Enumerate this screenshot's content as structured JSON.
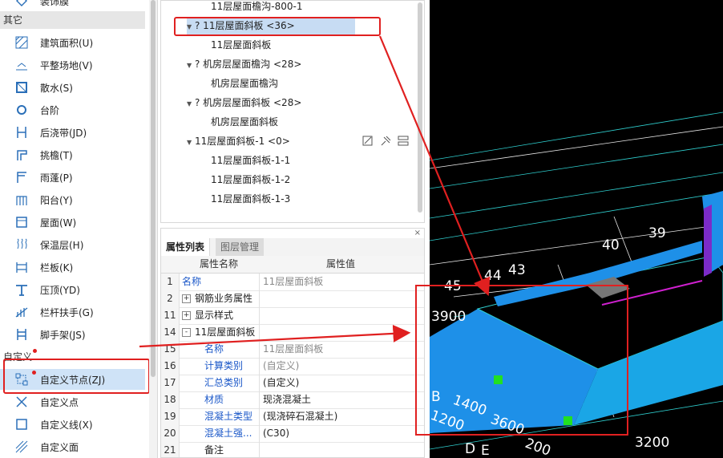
{
  "left_panel": {
    "top_partial_label": "装饰膜",
    "category_other": "其它",
    "items": [
      {
        "label": "建筑面积(U)",
        "icon": "area-hatch-icon"
      },
      {
        "label": "平整场地(V)",
        "icon": "leveling-icon"
      },
      {
        "label": "散水(S)",
        "icon": "apron-icon"
      },
      {
        "label": "台阶",
        "icon": "step-icon"
      },
      {
        "label": "后浇带(JD)",
        "icon": "post-pour-strip-icon"
      },
      {
        "label": "挑檐(T)",
        "icon": "cornice-icon"
      },
      {
        "label": "雨蓬(P)",
        "icon": "canopy-icon"
      },
      {
        "label": "阳台(Y)",
        "icon": "balcony-icon"
      },
      {
        "label": "屋面(W)",
        "icon": "roof-icon"
      },
      {
        "label": "保温层(H)",
        "icon": "insulation-icon"
      },
      {
        "label": "栏板(K)",
        "icon": "parapet-icon"
      },
      {
        "label": "压顶(YD)",
        "icon": "coping-icon"
      },
      {
        "label": "栏杆扶手(G)",
        "icon": "railing-icon"
      },
      {
        "label": "脚手架(JS)",
        "icon": "scaffold-icon"
      }
    ],
    "category_custom": "自定义",
    "custom_items": [
      {
        "label": "自定义节点(ZJ)",
        "icon": "custom-node-icon",
        "selected": true
      },
      {
        "label": "自定义点",
        "icon": "custom-point-icon"
      },
      {
        "label": "自定义线(X)",
        "icon": "custom-line-icon"
      },
      {
        "label": "自定义面",
        "icon": "custom-face-icon"
      }
    ]
  },
  "tree": {
    "nodes": [
      {
        "label": "11层屋面檐沟-800-1",
        "level": 1
      },
      {
        "label": "? 11层屋面斜板 <36>",
        "level": 0,
        "selected": true
      },
      {
        "label": "11层屋面斜板",
        "level": 1
      },
      {
        "label": "? 机房层屋面檐沟 <28>",
        "level": 0
      },
      {
        "label": "机房层屋面檐沟",
        "level": 1
      },
      {
        "label": "? 机房层屋面斜板 <28>",
        "level": 0
      },
      {
        "label": "机房层屋面斜板",
        "level": 1
      },
      {
        "label": "11层屋面斜板-1 <0>",
        "level": 0
      },
      {
        "label": "11层屋面斜板-1-1",
        "level": 1
      },
      {
        "label": "11层屋面斜板-1-2",
        "level": 1
      },
      {
        "label": "11层屋面斜板-1-3",
        "level": 1
      }
    ]
  },
  "properties": {
    "tabs": [
      "属性列表",
      "图层管理"
    ],
    "close_glyph": "×",
    "col_name": "属性名称",
    "col_value": "属性值",
    "rows": [
      {
        "num": "1",
        "name": "名称",
        "value": "11层屋面斜板",
        "name_blue": true,
        "value_gray": true
      },
      {
        "num": "2",
        "name": "钢筋业务属性",
        "value": "",
        "expander": "+"
      },
      {
        "num": "11",
        "name": "显示样式",
        "value": "",
        "expander": "+"
      },
      {
        "num": "14",
        "name": "11层屋面斜板",
        "value": "",
        "expander": "-"
      },
      {
        "num": "15",
        "name": "名称",
        "value": "11层屋面斜板",
        "name_blue": true,
        "value_gray": true,
        "indent": true
      },
      {
        "num": "16",
        "name": "计算类别",
        "value": "(自定义)",
        "name_blue": true,
        "value_gray": true,
        "indent": true
      },
      {
        "num": "17",
        "name": "汇总类别",
        "value": "(自定义)",
        "name_blue": true,
        "indent": true
      },
      {
        "num": "18",
        "name": "材质",
        "value": "现浇混凝土",
        "name_blue": true,
        "indent": true
      },
      {
        "num": "19",
        "name": "混凝土类型",
        "value": "(现浇碎石混凝土)",
        "name_blue": true,
        "indent": true
      },
      {
        "num": "20",
        "name": "混凝土强...",
        "value": "(C30)",
        "name_blue": true,
        "indent": true
      },
      {
        "num": "21",
        "name": "备注",
        "value": "",
        "indent": true
      }
    ]
  },
  "cad_labels": [
    "40",
    "39",
    "44",
    "43",
    "45",
    "3900",
    "1400",
    "3600",
    "1200",
    "200",
    "3200",
    "B",
    "D",
    "E"
  ],
  "colors": {
    "annotation_red": "#e02020",
    "cad_background": "#000000",
    "cad_blue": "#1e90e8"
  }
}
